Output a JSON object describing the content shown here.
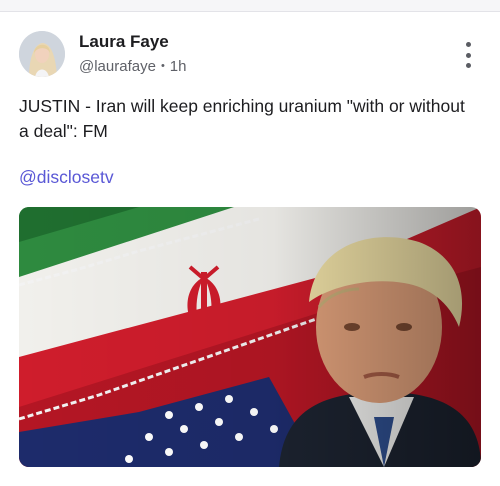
{
  "post": {
    "author": {
      "name": "Laura Faye",
      "handle": "@laurafaye",
      "time": "1h",
      "separator": "•"
    },
    "text": "JUSTIN - Iran will keep enriching uranium \"with or without a deal\": FM",
    "mention": "@disclosetv",
    "menu_icon": "more-vertical-icon",
    "media": {
      "type": "image",
      "description_icons": [
        "iran-flag",
        "us-flag",
        "portrait"
      ]
    }
  },
  "colors": {
    "link": "#5a58d6",
    "text": "#1d1d20",
    "muted": "#5f6168"
  }
}
